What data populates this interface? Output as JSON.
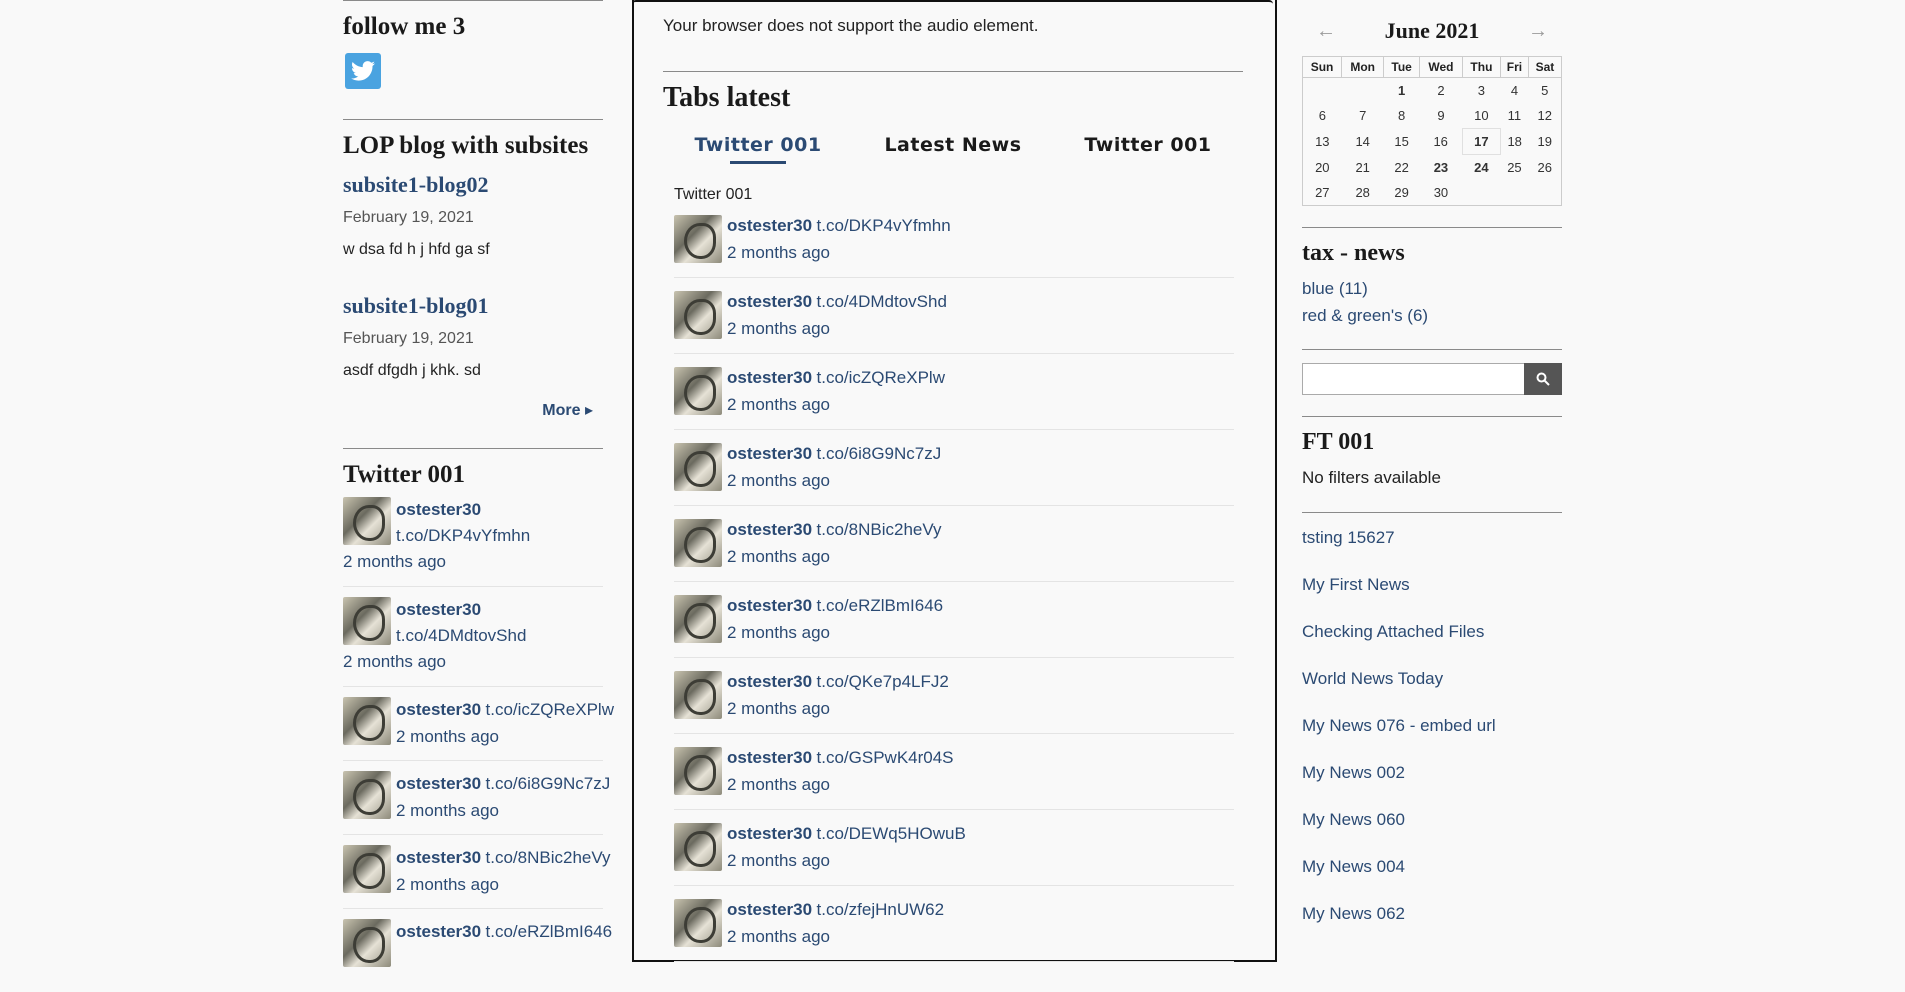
{
  "left": {
    "follow_title": "follow me 3",
    "blog_title": "LOP blog with subsites",
    "posts": [
      {
        "title": "subsite1-blog02",
        "date": "February 19, 2021",
        "excerpt": "w dsa fd h j hfd ga sf"
      },
      {
        "title": "subsite1-blog01",
        "date": "February 19, 2021",
        "excerpt": "asdf dfgdh j khk. sd"
      }
    ],
    "more_label": "More ▸",
    "twitter_title": "Twitter 001",
    "tweets": [
      {
        "user": "ostester30",
        "link": "t.co/DKP4vYfmhn",
        "time": "2 months ago"
      },
      {
        "user": "ostester30",
        "link": "t.co/4DMdtovShd",
        "time": "2 months ago"
      },
      {
        "user": "ostester30",
        "link": "t.co/icZQReXPlw",
        "time": "2 months ago"
      },
      {
        "user": "ostester30",
        "link": "t.co/6i8G9Nc7zJ",
        "time": "2 months ago"
      },
      {
        "user": "ostester30",
        "link": "t.co/8NBic2heVy",
        "time": "2 months ago"
      },
      {
        "user": "ostester30",
        "link": "t.co/eRZlBmI646",
        "time": ""
      }
    ]
  },
  "center": {
    "audio_msg": "Your browser does not support the audio element.",
    "tabs_title": "Tabs latest",
    "tabs": [
      "Twitter 001",
      "Latest News",
      "Twitter 001"
    ],
    "panel_label": "Twitter 001",
    "tweets": [
      {
        "user": "ostester30",
        "link": "t.co/DKP4vYfmhn",
        "time": "2 months ago"
      },
      {
        "user": "ostester30",
        "link": "t.co/4DMdtovShd",
        "time": "2 months ago"
      },
      {
        "user": "ostester30",
        "link": "t.co/icZQReXPlw",
        "time": "2 months ago"
      },
      {
        "user": "ostester30",
        "link": "t.co/6i8G9Nc7zJ",
        "time": "2 months ago"
      },
      {
        "user": "ostester30",
        "link": "t.co/8NBic2heVy",
        "time": "2 months ago"
      },
      {
        "user": "ostester30",
        "link": "t.co/eRZlBmI646",
        "time": "2 months ago"
      },
      {
        "user": "ostester30",
        "link": "t.co/QKe7p4LFJ2",
        "time": "2 months ago"
      },
      {
        "user": "ostester30",
        "link": "t.co/GSPwK4r04S",
        "time": "2 months ago"
      },
      {
        "user": "ostester30",
        "link": "t.co/DEWq5HOwuB",
        "time": "2 months ago"
      },
      {
        "user": "ostester30",
        "link": "t.co/zfejHnUW62",
        "time": "2 months ago"
      }
    ]
  },
  "right": {
    "calendar": {
      "month": "June 2021",
      "prev": "←",
      "next": "→",
      "weekdays": [
        "Sun",
        "Mon",
        "Tue",
        "Wed",
        "Thu",
        "Fri",
        "Sat"
      ],
      "weeks": [
        [
          "",
          "",
          "1",
          "2",
          "3",
          "4",
          "5"
        ],
        [
          "6",
          "7",
          "8",
          "9",
          "10",
          "11",
          "12"
        ],
        [
          "13",
          "14",
          "15",
          "16",
          "17",
          "18",
          "19"
        ],
        [
          "20",
          "21",
          "22",
          "23",
          "24",
          "25",
          "26"
        ],
        [
          "27",
          "28",
          "29",
          "30",
          "",
          "",
          ""
        ]
      ],
      "linked_days": [
        "1",
        "23",
        "24"
      ],
      "today": "17"
    },
    "tax_title": "tax - news",
    "tax_links": [
      "blue (11)",
      "red & green's (6)"
    ],
    "ft_title": "FT 001",
    "ft_text": "No filters available",
    "news_links": [
      "tsting 15627",
      "My First News",
      "Checking Attached Files",
      "World News Today",
      "My News 076 - embed url",
      "My News 002",
      "My News 060",
      "My News 004",
      "My News 062"
    ]
  },
  "colors": {
    "link": "#2b4a73",
    "twitter": "#4aa3e0",
    "today": "#2e8b57"
  }
}
